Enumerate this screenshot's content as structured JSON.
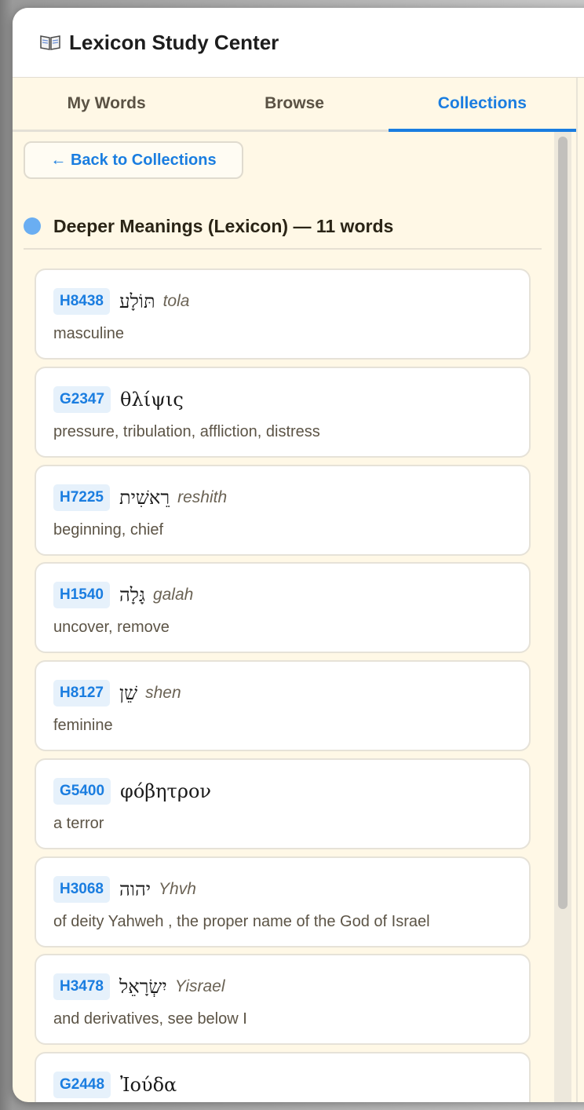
{
  "app": {
    "icon": "open-book-icon",
    "title": "Lexicon Study Center"
  },
  "tabs": [
    {
      "label": "My Words",
      "active": false
    },
    {
      "label": "Browse",
      "active": false
    },
    {
      "label": "Collections",
      "active": true
    }
  ],
  "back_button": {
    "label": "← Back to Collections"
  },
  "collection": {
    "title": "Deeper Meanings (Lexicon) — 11 words",
    "dot_color": "#6aaef2"
  },
  "entries": [
    {
      "code": "H8438",
      "lemma": "תּוֹלָע",
      "translit": "tola",
      "gloss": "masculine"
    },
    {
      "code": "G2347",
      "lemma": "θλίψις",
      "translit": "",
      "gloss": "pressure, tribulation, affliction, distress"
    },
    {
      "code": "H7225",
      "lemma": "רֵאשִׁית",
      "translit": "reshith",
      "gloss": "beginning, chief"
    },
    {
      "code": "H1540",
      "lemma": "גָּלָה",
      "translit": "galah",
      "gloss": "uncover, remove"
    },
    {
      "code": "H8127",
      "lemma": "שֵׁן",
      "translit": "shen",
      "gloss": "feminine"
    },
    {
      "code": "G5400",
      "lemma": "φόβητρον",
      "translit": "",
      "gloss": "a terror"
    },
    {
      "code": "H3068",
      "lemma": "יהוה",
      "translit": "Yhvh",
      "gloss": "of deity Yahweh , the proper name of the God of Israel"
    },
    {
      "code": "H3478",
      "lemma": "יִשְׂרָאֵל",
      "translit": "Yisrael",
      "gloss": "and derivatives, see below I"
    },
    {
      "code": "G2448",
      "lemma": "Ἰούδα",
      "translit": "",
      "gloss": ""
    }
  ],
  "colors": {
    "accent": "#1a7de0",
    "background": "#fff8e6",
    "card": "#ffffff",
    "badge_bg": "#e6f1fb"
  }
}
